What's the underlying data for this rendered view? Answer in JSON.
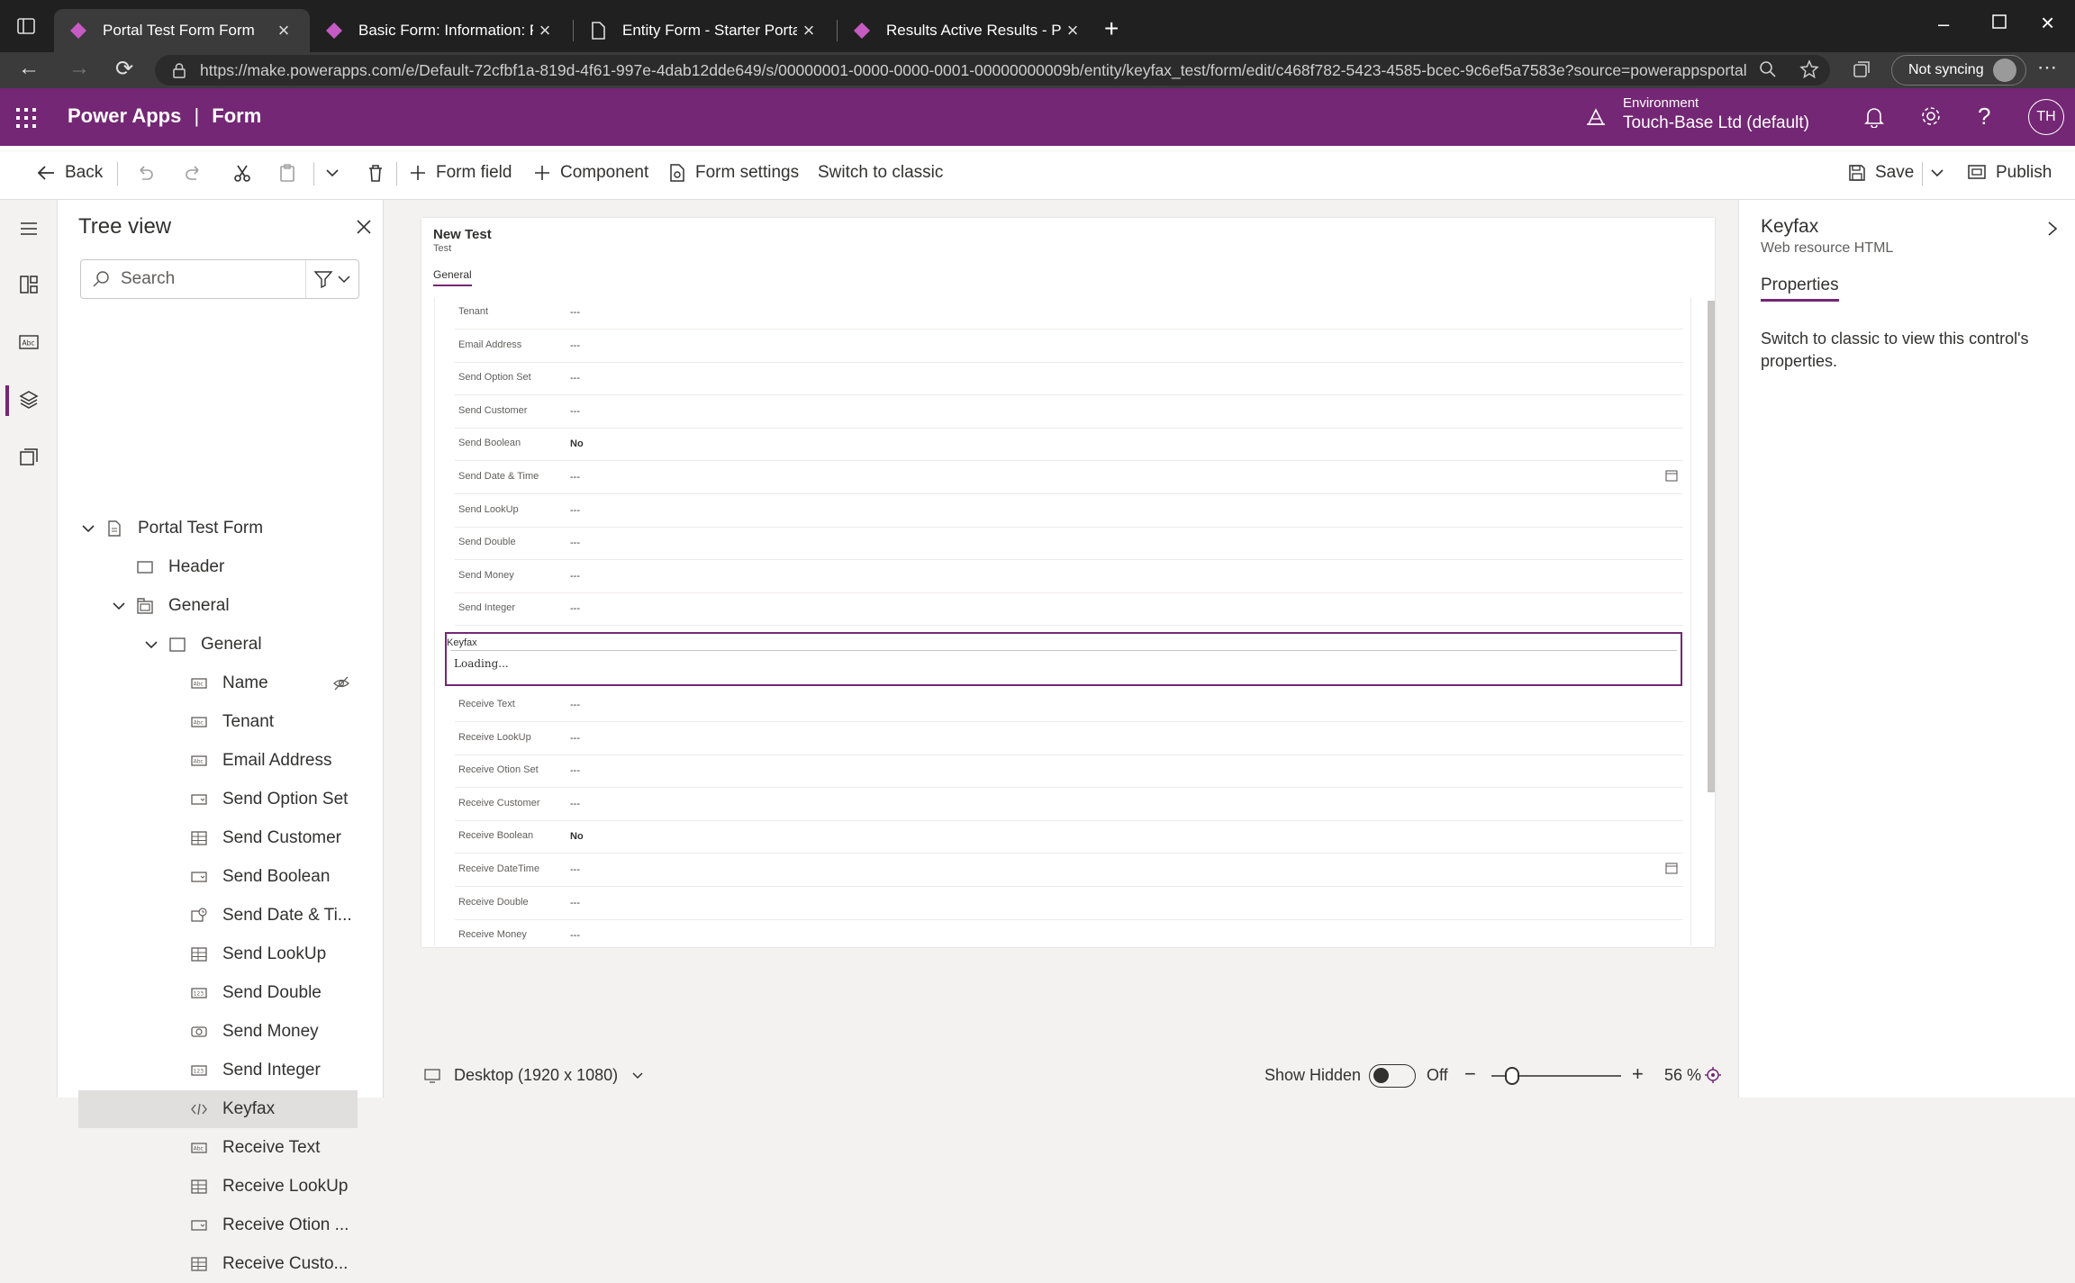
{
  "browser": {
    "tabs": [
      {
        "title": "Portal Test Form Form",
        "active": true
      },
      {
        "title": "Basic Form: Information: Portal Te",
        "active": false
      },
      {
        "title": "Entity Form - Starter Portal",
        "active": false
      },
      {
        "title": "Results Active Results - Power Ap",
        "active": false
      }
    ],
    "url": "https://make.powerapps.com/e/Default-72cfbf1a-819d-4f61-997e-4dab12dde649/s/00000001-0000-0000-0001-00000000009b/entity/keyfax_test/form/edit/c468f782-5423-4585-bcec-9c6ef5a7583e?source=powerappsportal",
    "sync_label": "Not syncing"
  },
  "header": {
    "app": "Power Apps",
    "separator": "|",
    "section": "Form",
    "env_label": "Environment",
    "env_name": "Touch-Base Ltd (default)",
    "avatar": "TH"
  },
  "commandbar": {
    "back": "Back",
    "form_field": "Form field",
    "component": "Component",
    "form_settings": "Form settings",
    "switch_classic": "Switch to classic",
    "save": "Save",
    "publish": "Publish"
  },
  "tree": {
    "title": "Tree view",
    "search_placeholder": "Search",
    "items": [
      {
        "label": "Portal Test Form",
        "icon": "form-icon"
      },
      {
        "label": "Header",
        "icon": "header-icon"
      },
      {
        "label": "General",
        "icon": "tab-icon"
      },
      {
        "label": "General",
        "icon": "section-icon"
      },
      {
        "label": "Name",
        "icon": "text-field-icon"
      },
      {
        "label": "Tenant",
        "icon": "text-field-icon"
      },
      {
        "label": "Email Address",
        "icon": "text-field-icon"
      },
      {
        "label": "Send Option Set",
        "icon": "option-set-icon"
      },
      {
        "label": "Send Customer",
        "icon": "lookup-icon"
      },
      {
        "label": "Send Boolean",
        "icon": "option-set-icon"
      },
      {
        "label": "Send Date & Ti...",
        "icon": "datetime-icon"
      },
      {
        "label": "Send LookUp",
        "icon": "lookup-icon"
      },
      {
        "label": "Send Double",
        "icon": "number-icon"
      },
      {
        "label": "Send Money",
        "icon": "money-icon"
      },
      {
        "label": "Send Integer",
        "icon": "number-icon"
      },
      {
        "label": "Keyfax",
        "icon": "code-icon"
      },
      {
        "label": "Receive Text",
        "icon": "text-field-icon"
      },
      {
        "label": "Receive LookUp",
        "icon": "lookup-icon"
      },
      {
        "label": "Receive Otion ...",
        "icon": "option-set-icon"
      },
      {
        "label": "Receive Custo...",
        "icon": "lookup-icon"
      }
    ]
  },
  "form": {
    "title": "New Test",
    "subtitle": "Test",
    "tab": "General",
    "fields": [
      {
        "label": "Tenant",
        "value": "---"
      },
      {
        "label": "Email Address",
        "value": "---"
      },
      {
        "label": "Send Option Set",
        "value": "---"
      },
      {
        "label": "Send Customer",
        "value": "---"
      },
      {
        "label": "Send Boolean",
        "value": "No"
      },
      {
        "label": "Send Date & Time",
        "value": "---"
      },
      {
        "label": "Send LookUp",
        "value": "---"
      },
      {
        "label": "Send Double",
        "value": "---"
      },
      {
        "label": "Send Money",
        "value": "---"
      },
      {
        "label": "Send Integer",
        "value": "---"
      }
    ],
    "keyfax": {
      "label": "Keyfax",
      "content": "Loading..."
    },
    "fields2": [
      {
        "label": "Receive Text",
        "value": "---"
      },
      {
        "label": "Receive LookUp",
        "value": "---"
      },
      {
        "label": "Receive Otion Set",
        "value": "---"
      },
      {
        "label": "Receive Customer",
        "value": "---"
      },
      {
        "label": "Receive Boolean",
        "value": "No"
      },
      {
        "label": "Receive DateTime",
        "value": "---"
      },
      {
        "label": "Receive Double",
        "value": "---"
      },
      {
        "label": "Receive Money",
        "value": "---"
      }
    ]
  },
  "status": {
    "device": "Desktop (1920 x 1080)",
    "show_hidden": "Show Hidden",
    "toggle_state": "Off",
    "zoom": "56 %",
    "zoom_level": 0.56
  },
  "props": {
    "title": "Keyfax",
    "subtitle": "Web resource HTML",
    "tab": "Properties",
    "message": "Switch to classic to view this control's properties."
  },
  "colors": {
    "brand": "#742774",
    "chrome": "#202020"
  }
}
